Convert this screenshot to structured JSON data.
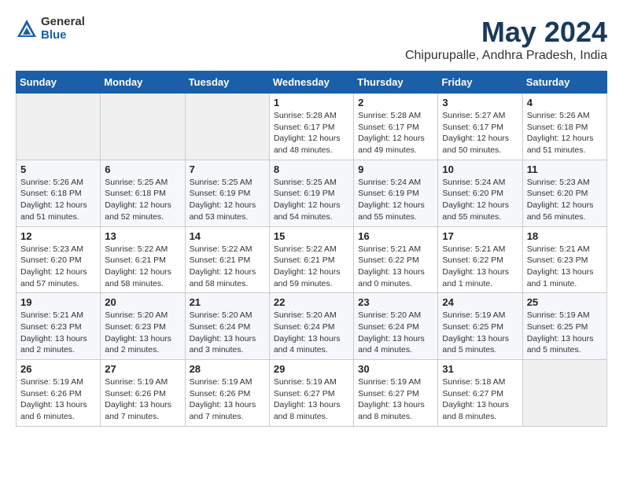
{
  "header": {
    "logo_general": "General",
    "logo_blue": "Blue",
    "month": "May 2024",
    "location": "Chipurupalle, Andhra Pradesh, India"
  },
  "weekdays": [
    "Sunday",
    "Monday",
    "Tuesday",
    "Wednesday",
    "Thursday",
    "Friday",
    "Saturday"
  ],
  "weeks": [
    [
      {
        "day": "",
        "sunrise": "",
        "sunset": "",
        "daylight": ""
      },
      {
        "day": "",
        "sunrise": "",
        "sunset": "",
        "daylight": ""
      },
      {
        "day": "",
        "sunrise": "",
        "sunset": "",
        "daylight": ""
      },
      {
        "day": "1",
        "sunrise": "Sunrise: 5:28 AM",
        "sunset": "Sunset: 6:17 PM",
        "daylight": "Daylight: 12 hours and 48 minutes."
      },
      {
        "day": "2",
        "sunrise": "Sunrise: 5:28 AM",
        "sunset": "Sunset: 6:17 PM",
        "daylight": "Daylight: 12 hours and 49 minutes."
      },
      {
        "day": "3",
        "sunrise": "Sunrise: 5:27 AM",
        "sunset": "Sunset: 6:17 PM",
        "daylight": "Daylight: 12 hours and 50 minutes."
      },
      {
        "day": "4",
        "sunrise": "Sunrise: 5:26 AM",
        "sunset": "Sunset: 6:18 PM",
        "daylight": "Daylight: 12 hours and 51 minutes."
      }
    ],
    [
      {
        "day": "5",
        "sunrise": "Sunrise: 5:26 AM",
        "sunset": "Sunset: 6:18 PM",
        "daylight": "Daylight: 12 hours and 51 minutes."
      },
      {
        "day": "6",
        "sunrise": "Sunrise: 5:25 AM",
        "sunset": "Sunset: 6:18 PM",
        "daylight": "Daylight: 12 hours and 52 minutes."
      },
      {
        "day": "7",
        "sunrise": "Sunrise: 5:25 AM",
        "sunset": "Sunset: 6:19 PM",
        "daylight": "Daylight: 12 hours and 53 minutes."
      },
      {
        "day": "8",
        "sunrise": "Sunrise: 5:25 AM",
        "sunset": "Sunset: 6:19 PM",
        "daylight": "Daylight: 12 hours and 54 minutes."
      },
      {
        "day": "9",
        "sunrise": "Sunrise: 5:24 AM",
        "sunset": "Sunset: 6:19 PM",
        "daylight": "Daylight: 12 hours and 55 minutes."
      },
      {
        "day": "10",
        "sunrise": "Sunrise: 5:24 AM",
        "sunset": "Sunset: 6:20 PM",
        "daylight": "Daylight: 12 hours and 55 minutes."
      },
      {
        "day": "11",
        "sunrise": "Sunrise: 5:23 AM",
        "sunset": "Sunset: 6:20 PM",
        "daylight": "Daylight: 12 hours and 56 minutes."
      }
    ],
    [
      {
        "day": "12",
        "sunrise": "Sunrise: 5:23 AM",
        "sunset": "Sunset: 6:20 PM",
        "daylight": "Daylight: 12 hours and 57 minutes."
      },
      {
        "day": "13",
        "sunrise": "Sunrise: 5:22 AM",
        "sunset": "Sunset: 6:21 PM",
        "daylight": "Daylight: 12 hours and 58 minutes."
      },
      {
        "day": "14",
        "sunrise": "Sunrise: 5:22 AM",
        "sunset": "Sunset: 6:21 PM",
        "daylight": "Daylight: 12 hours and 58 minutes."
      },
      {
        "day": "15",
        "sunrise": "Sunrise: 5:22 AM",
        "sunset": "Sunset: 6:21 PM",
        "daylight": "Daylight: 12 hours and 59 minutes."
      },
      {
        "day": "16",
        "sunrise": "Sunrise: 5:21 AM",
        "sunset": "Sunset: 6:22 PM",
        "daylight": "Daylight: 13 hours and 0 minutes."
      },
      {
        "day": "17",
        "sunrise": "Sunrise: 5:21 AM",
        "sunset": "Sunset: 6:22 PM",
        "daylight": "Daylight: 13 hours and 1 minute."
      },
      {
        "day": "18",
        "sunrise": "Sunrise: 5:21 AM",
        "sunset": "Sunset: 6:23 PM",
        "daylight": "Daylight: 13 hours and 1 minute."
      }
    ],
    [
      {
        "day": "19",
        "sunrise": "Sunrise: 5:21 AM",
        "sunset": "Sunset: 6:23 PM",
        "daylight": "Daylight: 13 hours and 2 minutes."
      },
      {
        "day": "20",
        "sunrise": "Sunrise: 5:20 AM",
        "sunset": "Sunset: 6:23 PM",
        "daylight": "Daylight: 13 hours and 2 minutes."
      },
      {
        "day": "21",
        "sunrise": "Sunrise: 5:20 AM",
        "sunset": "Sunset: 6:24 PM",
        "daylight": "Daylight: 13 hours and 3 minutes."
      },
      {
        "day": "22",
        "sunrise": "Sunrise: 5:20 AM",
        "sunset": "Sunset: 6:24 PM",
        "daylight": "Daylight: 13 hours and 4 minutes."
      },
      {
        "day": "23",
        "sunrise": "Sunrise: 5:20 AM",
        "sunset": "Sunset: 6:24 PM",
        "daylight": "Daylight: 13 hours and 4 minutes."
      },
      {
        "day": "24",
        "sunrise": "Sunrise: 5:19 AM",
        "sunset": "Sunset: 6:25 PM",
        "daylight": "Daylight: 13 hours and 5 minutes."
      },
      {
        "day": "25",
        "sunrise": "Sunrise: 5:19 AM",
        "sunset": "Sunset: 6:25 PM",
        "daylight": "Daylight: 13 hours and 5 minutes."
      }
    ],
    [
      {
        "day": "26",
        "sunrise": "Sunrise: 5:19 AM",
        "sunset": "Sunset: 6:26 PM",
        "daylight": "Daylight: 13 hours and 6 minutes."
      },
      {
        "day": "27",
        "sunrise": "Sunrise: 5:19 AM",
        "sunset": "Sunset: 6:26 PM",
        "daylight": "Daylight: 13 hours and 7 minutes."
      },
      {
        "day": "28",
        "sunrise": "Sunrise: 5:19 AM",
        "sunset": "Sunset: 6:26 PM",
        "daylight": "Daylight: 13 hours and 7 minutes."
      },
      {
        "day": "29",
        "sunrise": "Sunrise: 5:19 AM",
        "sunset": "Sunset: 6:27 PM",
        "daylight": "Daylight: 13 hours and 8 minutes."
      },
      {
        "day": "30",
        "sunrise": "Sunrise: 5:19 AM",
        "sunset": "Sunset: 6:27 PM",
        "daylight": "Daylight: 13 hours and 8 minutes."
      },
      {
        "day": "31",
        "sunrise": "Sunrise: 5:18 AM",
        "sunset": "Sunset: 6:27 PM",
        "daylight": "Daylight: 13 hours and 8 minutes."
      },
      {
        "day": "",
        "sunrise": "",
        "sunset": "",
        "daylight": ""
      }
    ]
  ]
}
